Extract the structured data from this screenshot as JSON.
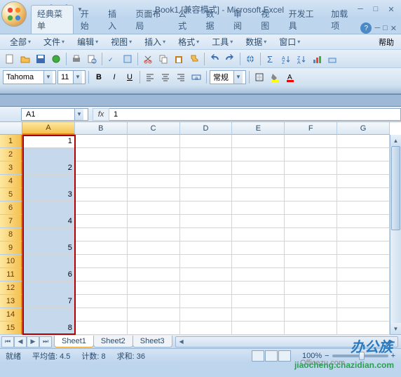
{
  "window": {
    "title": "Book1 [兼容模式] - Microsoft Excel"
  },
  "ribbon": {
    "tabs": [
      "经典菜单",
      "开始",
      "插入",
      "页面布局",
      "公式",
      "数据",
      "审阅",
      "视图",
      "开发工具",
      "加载项"
    ],
    "active": 0
  },
  "menus": [
    "全部",
    "文件",
    "编辑",
    "视图",
    "插入",
    "格式",
    "工具",
    "数据",
    "窗口"
  ],
  "menu_help": "帮助",
  "format": {
    "font": "Tahoma",
    "size": "11",
    "numfmt": "常规"
  },
  "name_box": "A1",
  "formula_value": "1",
  "columns": [
    "A",
    "B",
    "C",
    "D",
    "E",
    "F",
    "G"
  ],
  "rows": 15,
  "cell_data": {
    "A1": "1",
    "A3": "2",
    "A5": "3",
    "A7": "4",
    "A9": "5",
    "A11": "6",
    "A13": "7",
    "A15": "8"
  },
  "selection": {
    "col": "A",
    "anchor_row": 1,
    "from_row": 1,
    "to_row": 15
  },
  "sheets": [
    "Sheet1",
    "Sheet2",
    "Sheet3"
  ],
  "active_sheet": 0,
  "status": {
    "mode": "就绪",
    "avg_label": "平均值:",
    "avg": "4.5",
    "count_label": "计数:",
    "count": "8",
    "sum_label": "求和:",
    "sum": "36",
    "zoom": "100%"
  },
  "watermarks": {
    "w1": "办公族",
    "w2": "Officezu.com",
    "w3": "jiaocheng.chazidian.com"
  }
}
